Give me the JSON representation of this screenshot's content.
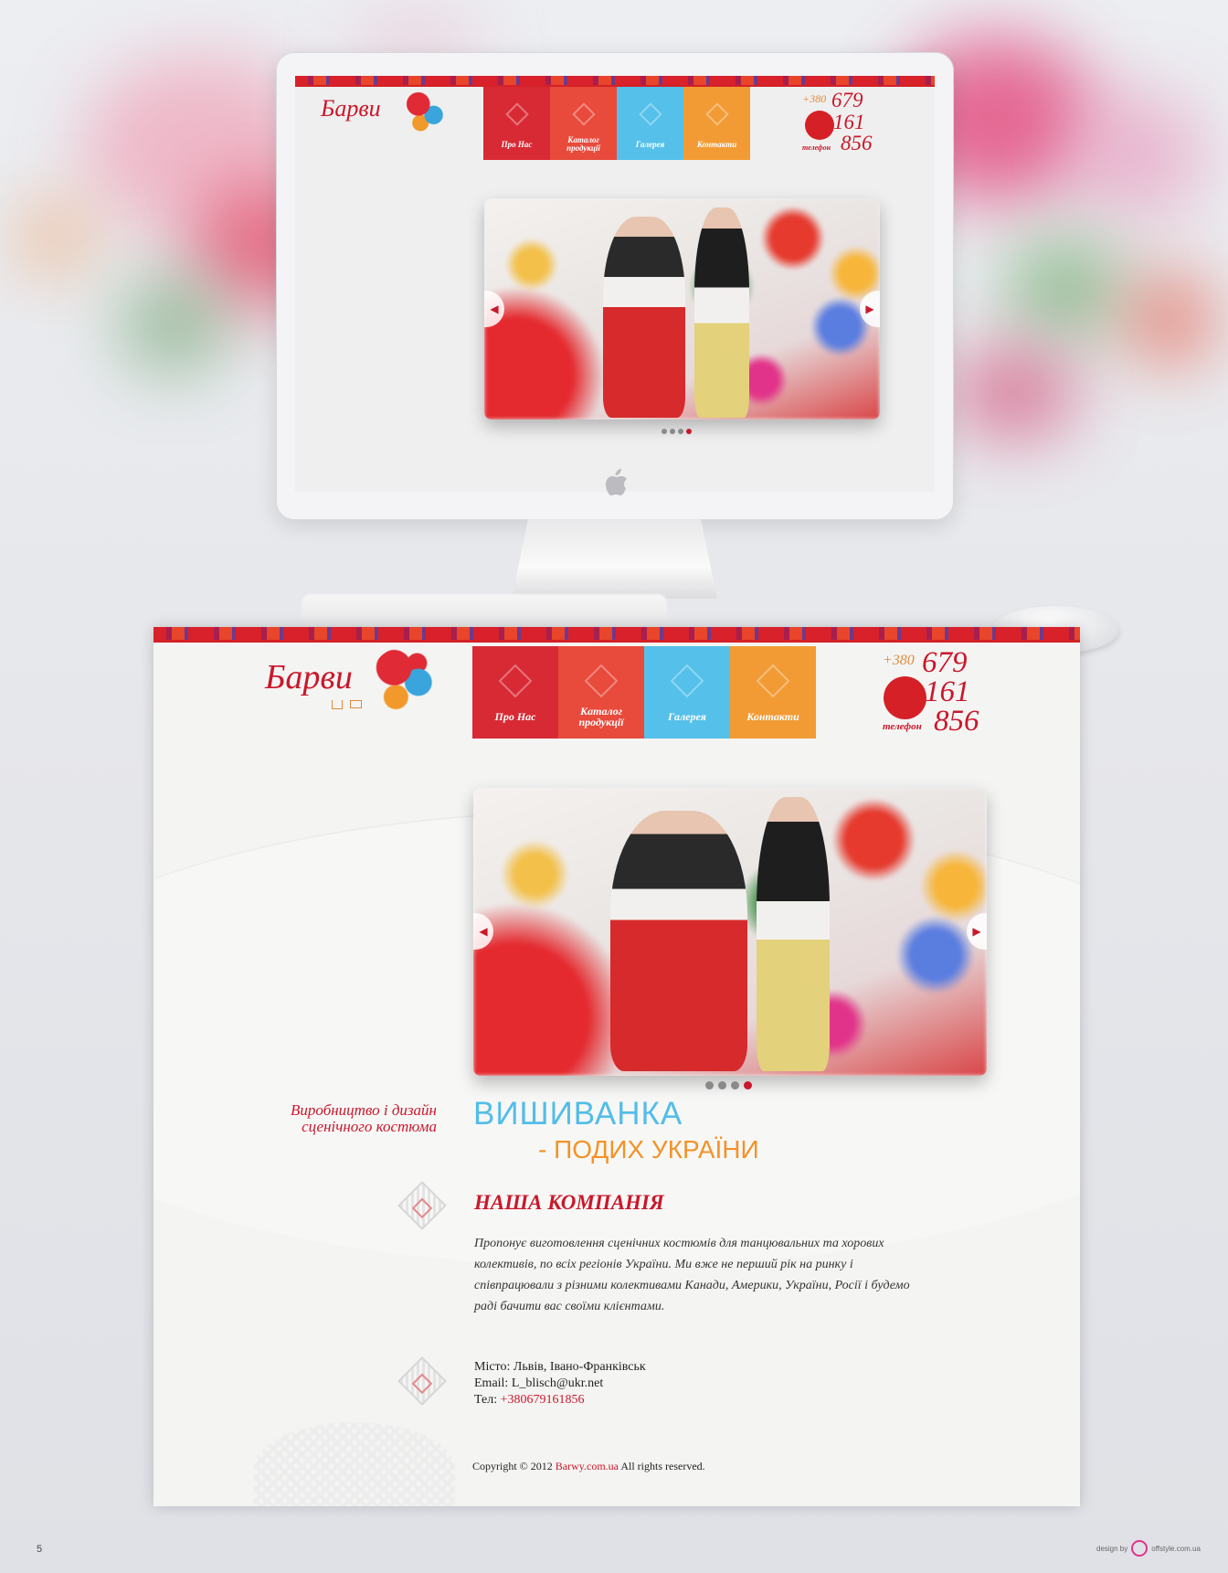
{
  "brand": {
    "logo_text": "Барви"
  },
  "nav": {
    "items": [
      {
        "label": "Про Нас",
        "color": "#d82a35"
      },
      {
        "label": "Каталог продукції",
        "color": "#e84a3c"
      },
      {
        "label": "Галерея",
        "color": "#55c0ea"
      },
      {
        "label": "Контакти",
        "color": "#f29b35"
      }
    ]
  },
  "phone": {
    "prefix": "+380",
    "line1": "679",
    "line2": "161",
    "line3": "856",
    "caption": "телефон"
  },
  "slider": {
    "total_slides": 4,
    "active_slide": 4
  },
  "tagline": {
    "line1": "Виробництво і дизайн",
    "line2": "сценічного костюма"
  },
  "headline": {
    "line1": "ВИШИВАНКА",
    "line2": "- ПОДИХ УКРАЇНИ"
  },
  "company": {
    "title": "НАША КОМПАНІЯ",
    "text": "Пропонує виготовлення сценічних костюмів для танцювальних та хорових колективів, по всіх регіонів України. Ми вже не перший рік на ринку і співпрацювали з різними колективами Канади, Америки, України, Росії і будемо раді бачити вас своїми клієнтами."
  },
  "contacts": {
    "city": "Місто: Львів, Івано-Франківськ",
    "email": "Email: L_blisch@ukr.net",
    "phone_label": "Тел:",
    "phone_value": "+380679161856"
  },
  "footer": {
    "copyright_pre": "Copyright © 2012",
    "site": "Barwy.com.ua",
    "rights": "All rights reserved."
  },
  "slide_page_number": "5",
  "credit": {
    "design_by": "design by",
    "studio": "offstyle.com.ua"
  },
  "colors": {
    "accent_red": "#c9182b",
    "blue": "#53bde8",
    "orange": "#f29327"
  }
}
